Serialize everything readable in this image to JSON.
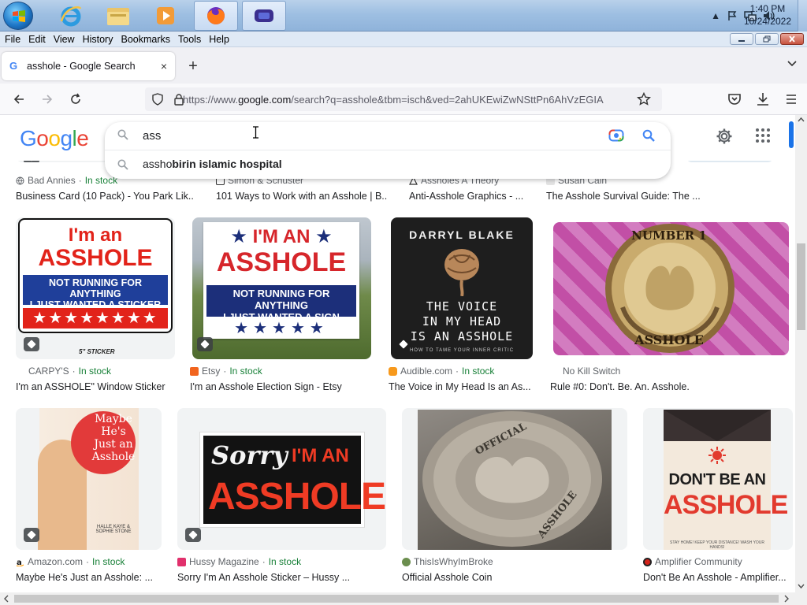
{
  "taskbar": {
    "apps": [
      {
        "name": "internet-explorer"
      },
      {
        "name": "file-explorer"
      },
      {
        "name": "media-player"
      },
      {
        "name": "firefox",
        "active": true
      },
      {
        "name": "gamepad",
        "active": true
      }
    ],
    "time": "1:40 PM",
    "date": "10/24/2022"
  },
  "menubar": {
    "items": [
      "File",
      "Edit",
      "View",
      "History",
      "Bookmarks",
      "Tools",
      "Help"
    ]
  },
  "tab": {
    "title": "asshole - Google Search",
    "close": "×",
    "new_tab": "+"
  },
  "nav": {
    "url_prefix": "https://www.",
    "url_host": "google.com",
    "url_rest": "/search?q=asshole&tbm=isch&ved=2ahUKEwiZwNSttPn6AhVzEGIA"
  },
  "search": {
    "query": "ass",
    "suggestion_prefix": "assho",
    "suggestion_rest": "birin islamic hospital"
  },
  "top_row": [
    {
      "source": "Bad Annies",
      "stock": "In stock",
      "title": "Business Card (10 Pack) - You Park Lik..."
    },
    {
      "source": "Simon & Schuster",
      "stock": "",
      "title": "101 Ways to Work with an Asshole | B..."
    },
    {
      "source": "Assholes A Theory",
      "stock": "",
      "title": "Anti-Asshole Graphics - ..."
    },
    {
      "source": "Susan Cain",
      "stock": "",
      "title": "The Asshole Survival Guide: The ..."
    }
  ],
  "row2": [
    {
      "source": "CARPY'S",
      "stock": "In stock",
      "title": "I'm an ASSHOLE\" Window Sticker",
      "img": {
        "line1": "I'm an",
        "line2": "ASSHOLE",
        "line3": "NOT RUNNING FOR ANYTHING",
        "line4": "I JUST WANTED A STICKER",
        "note": "5\" STICKER"
      }
    },
    {
      "source": "Etsy",
      "stock": "In stock",
      "title": "I'm an Asshole Election Sign - Etsy",
      "img": {
        "line1": "I'M AN",
        "line2": "ASSHOLE",
        "line3": "NOT RUNNING FOR ANYTHING",
        "line4": "I JUST WANTED A SIGN"
      }
    },
    {
      "source": "Audible.com",
      "stock": "In stock",
      "title": "The Voice in My Head Is an As...",
      "img": {
        "author": "DARRYL BLAKE",
        "line1": "THE VOICE",
        "line2": "IN MY HEAD",
        "line3": "IS AN ASSHOLE",
        "sub": "HOW TO TAME YOUR INNER CRITIC"
      }
    },
    {
      "source": "No Kill Switch",
      "stock": "",
      "title": "Rule #0: Don't. Be. An. Asshole.",
      "img": {
        "top": "NUMBER 1",
        "bottom": "ASSHOLE"
      }
    }
  ],
  "row3": [
    {
      "source": "Amazon.com",
      "stock": "In stock",
      "title": "Maybe He's Just an Asshole: ...",
      "img": {
        "line1": "Maybe",
        "line2": "He's",
        "line3": "Just an",
        "line4": "Asshole",
        "authors": "HALLE KAYE & SOPHIE STONE"
      }
    },
    {
      "source": "Hussy Magazine",
      "stock": "In stock",
      "title": "Sorry I'm An Asshole Sticker – Hussy ...",
      "img": {
        "line1": "Sorry",
        "line2": "I'M AN",
        "line3": "ASSHOLE"
      }
    },
    {
      "source": "ThisIsWhyImBroke",
      "stock": "",
      "title": "Official Asshole Coin",
      "img": {
        "top": "OFFICIAL",
        "bottom": "ASSHOLE"
      }
    },
    {
      "source": "Amplifier Community",
      "stock": "",
      "title": "Don't Be An Asshole - Amplifier...",
      "img": {
        "line1": "DON'T BE AN",
        "line2": "ASSHOLE",
        "sub": "STAY HOME! KEEP YOUR DISTANCE! WASH YOUR HANDS!"
      }
    }
  ],
  "colors": {
    "google_blue": "#4285f4",
    "google_red": "#ea4335",
    "google_yellow": "#fbbc05",
    "google_green": "#34a853",
    "in_stock_green": "#188038",
    "source_gray": "#5f6368"
  }
}
